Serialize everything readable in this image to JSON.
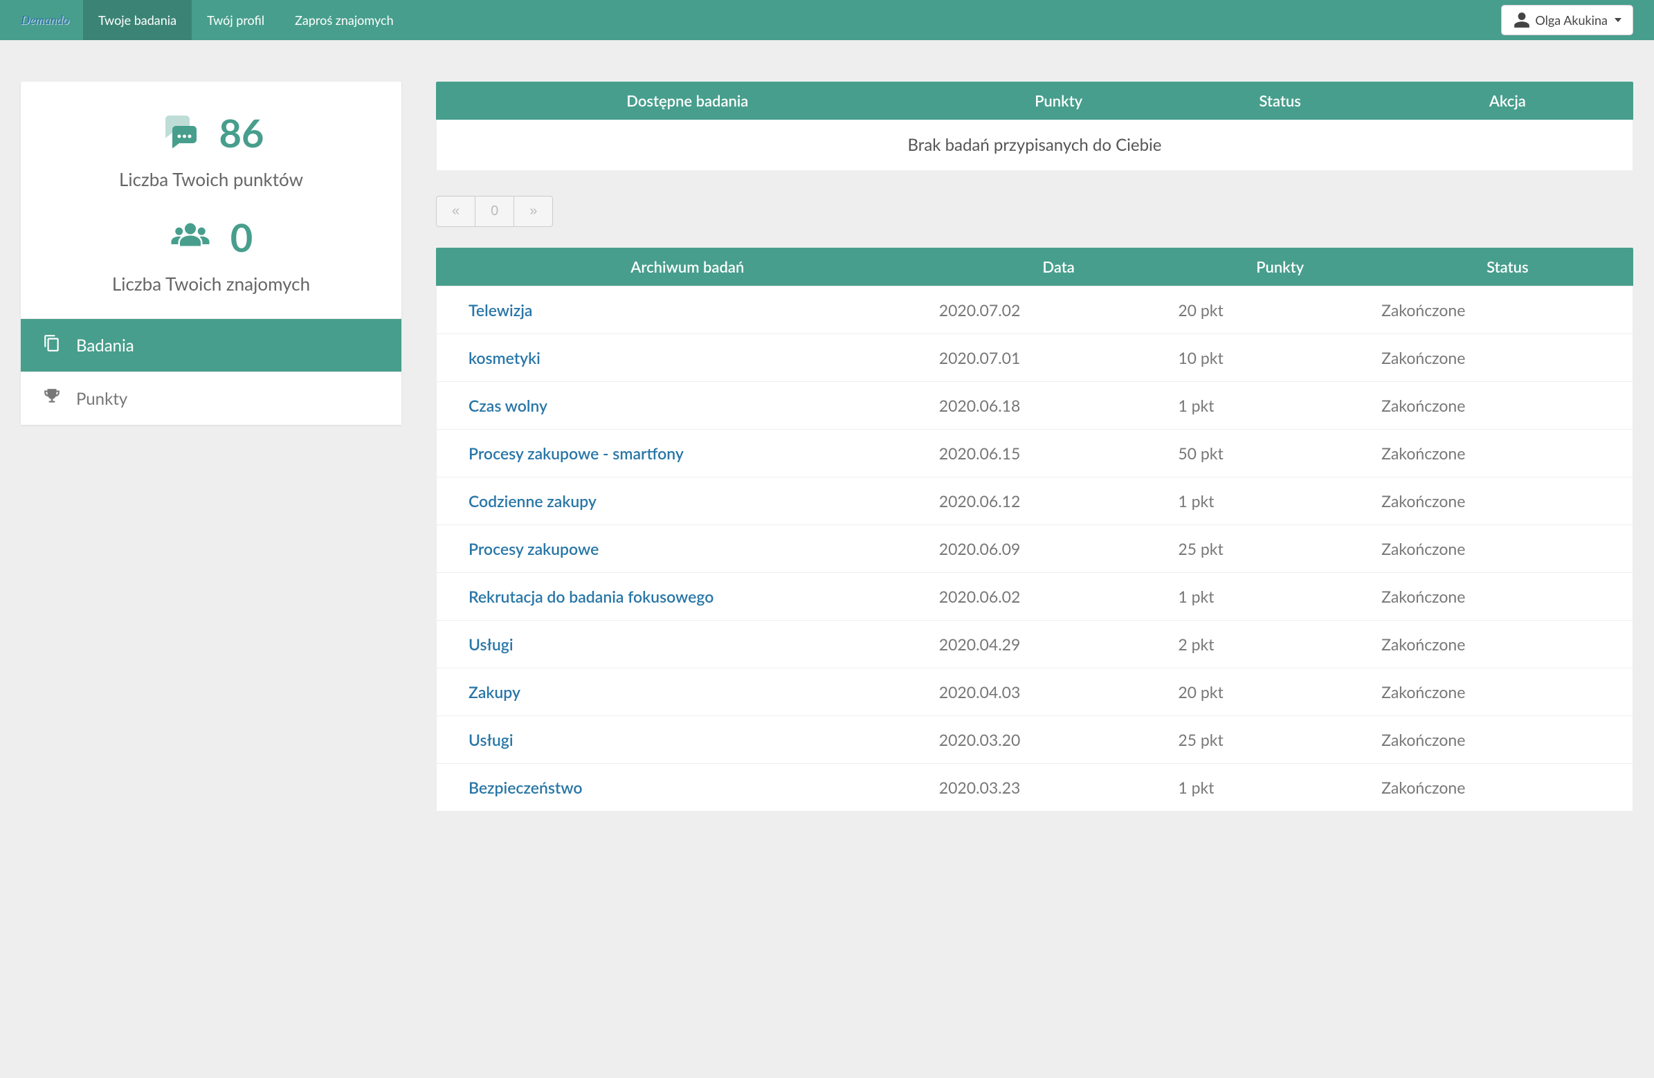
{
  "logo_text": "Demando",
  "nav": {
    "items": [
      {
        "label": "Twoje badania",
        "active": true
      },
      {
        "label": "Twój profil",
        "active": false
      },
      {
        "label": "Zaproś znajomych",
        "active": false
      }
    ]
  },
  "user": {
    "name": "Olga Akukina"
  },
  "sidebar": {
    "points_value": "86",
    "points_label": "Liczba Twoich punktów",
    "friends_value": "0",
    "friends_label": "Liczba Twoich znajomych",
    "menu": [
      {
        "label": "Badania",
        "active": true,
        "icon": "copy-icon"
      },
      {
        "label": "Punkty",
        "active": false,
        "icon": "trophy-icon"
      }
    ]
  },
  "available": {
    "headers": {
      "name": "Dostępne badania",
      "points": "Punkty",
      "status": "Status",
      "action": "Akcja"
    },
    "empty_message": "Brak badań przypisanych do Ciebie"
  },
  "pager": {
    "prev": "«",
    "page": "0",
    "next": "»"
  },
  "archive": {
    "headers": {
      "name": "Archiwum badań",
      "date": "Data",
      "points": "Punkty",
      "status": "Status"
    },
    "rows": [
      {
        "name": "Telewizja",
        "date": "2020.07.02",
        "points": "20 pkt",
        "status": "Zakończone"
      },
      {
        "name": "kosmetyki",
        "date": "2020.07.01",
        "points": "10 pkt",
        "status": "Zakończone"
      },
      {
        "name": "Czas wolny",
        "date": "2020.06.18",
        "points": "1 pkt",
        "status": "Zakończone"
      },
      {
        "name": "Procesy zakupowe - smartfony",
        "date": "2020.06.15",
        "points": "50 pkt",
        "status": "Zakończone"
      },
      {
        "name": "Codzienne zakupy",
        "date": "2020.06.12",
        "points": "1 pkt",
        "status": "Zakończone"
      },
      {
        "name": "Procesy zakupowe",
        "date": "2020.06.09",
        "points": "25 pkt",
        "status": "Zakończone"
      },
      {
        "name": "Rekrutacja do badania fokusowego",
        "date": "2020.06.02",
        "points": "1 pkt",
        "status": "Zakończone"
      },
      {
        "name": "Usługi",
        "date": "2020.04.29",
        "points": "2 pkt",
        "status": "Zakończone"
      },
      {
        "name": "Zakupy",
        "date": "2020.04.03",
        "points": "20 pkt",
        "status": "Zakończone"
      },
      {
        "name": "Usługi",
        "date": "2020.03.20",
        "points": "25 pkt",
        "status": "Zakończone"
      },
      {
        "name": "Bezpieczeństwo",
        "date": "2020.03.23",
        "points": "1 pkt",
        "status": "Zakończone"
      }
    ]
  }
}
